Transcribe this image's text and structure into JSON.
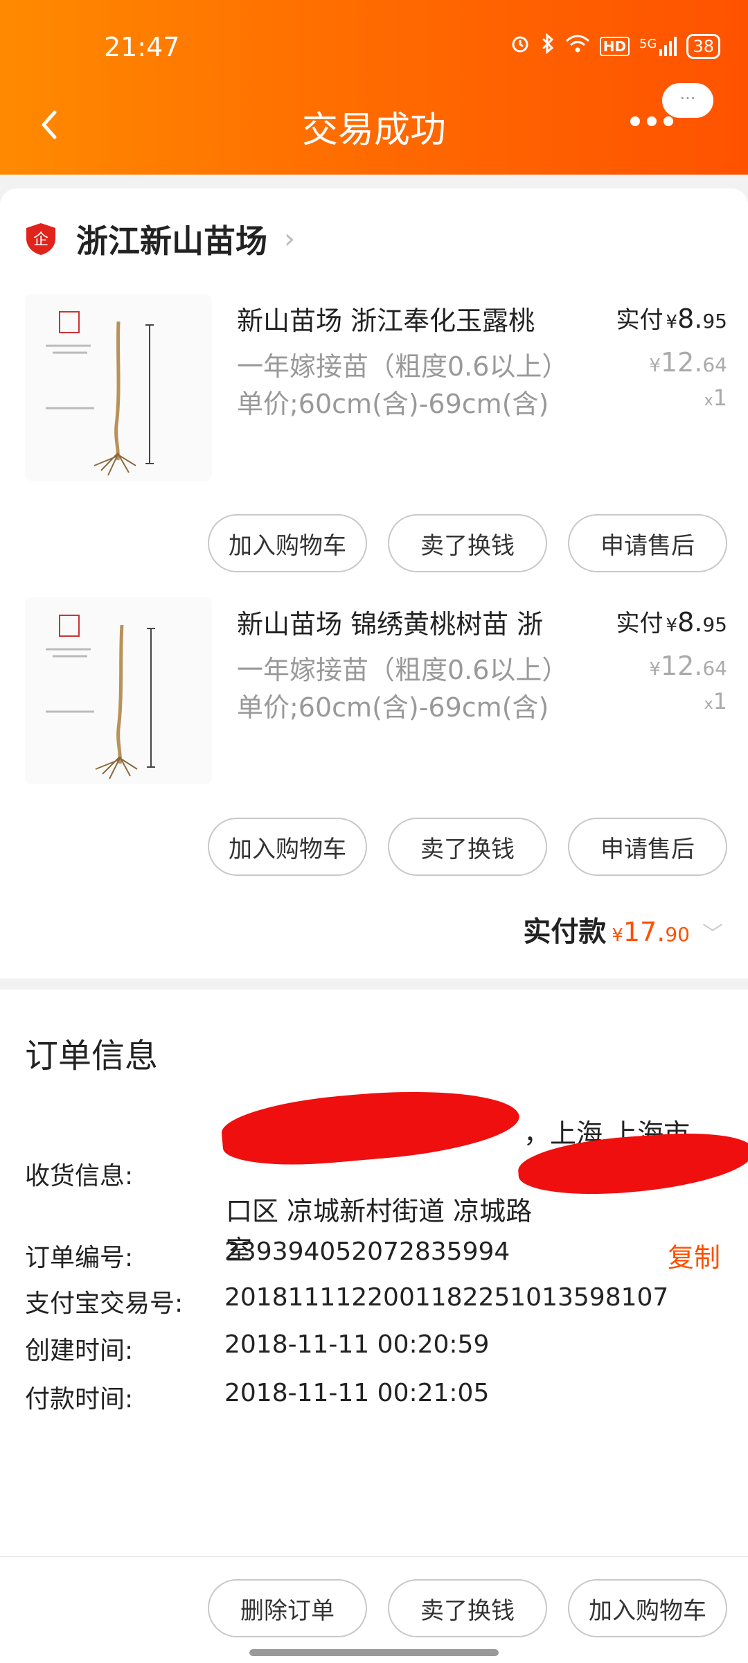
{
  "status_bar": {
    "time": "21:47",
    "network": "5G",
    "hd": "HD",
    "battery": "38",
    "icons": [
      "alarm-icon",
      "bluetooth-icon",
      "wifi-icon",
      "hd-icon",
      "signal-icon",
      "battery-icon"
    ]
  },
  "header": {
    "title": "交易成功",
    "more_bubble": "···"
  },
  "shop": {
    "name": "浙江新山苗场",
    "badge": "企"
  },
  "items": [
    {
      "title": "新山苗场 浙江奉化玉露桃",
      "spec": "一年嫁接苗（粗度0.6以上）单价;60cm(含)-69cm(含)",
      "paid_label": "实付",
      "currency": "¥",
      "paid_int": "8.",
      "paid_dec": "95",
      "orig_int": "12.",
      "orig_dec": "64",
      "qty_x": "x",
      "qty": "1",
      "buttons": [
        "加入购物车",
        "卖了换钱",
        "申请售后"
      ]
    },
    {
      "title": "新山苗场 锦绣黄桃树苗 浙",
      "spec": "一年嫁接苗（粗度0.6以上）单价;60cm(含)-69cm(含)",
      "paid_label": "实付",
      "currency": "¥",
      "paid_int": "8.",
      "paid_dec": "95",
      "orig_int": "12.",
      "orig_dec": "64",
      "qty_x": "x",
      "qty": "1",
      "buttons": [
        "加入购物车",
        "卖了换钱",
        "申请售后"
      ]
    }
  ],
  "total": {
    "label": "实付款",
    "currency": "¥",
    "int": "17.",
    "dec": "90"
  },
  "order_info": {
    "title": "订单信息",
    "address_label": "收货信息:",
    "address_line1": "，上海 上海市 虹",
    "address_line2": "口区 凉城新村街道 凉城路",
    "address_line3": "室",
    "order_no_label": "订单编号:",
    "order_no": "239394052072835994",
    "copy": "复制",
    "alipay_label": "支付宝交易号:",
    "alipay_no": "2018111122001182251013598107",
    "created_label": "创建时间:",
    "created": "2018-11-11 00:20:59",
    "paid_label": "付款时间:",
    "paid": "2018-11-11 00:21:05"
  },
  "bottom_bar": {
    "buttons": [
      "删除订单",
      "卖了换钱",
      "加入购物车"
    ]
  },
  "colors": {
    "header_start": "#ff8a00",
    "header_end": "#ff5200",
    "accent": "#ff5000",
    "redaction": "#ef0f0f"
  }
}
